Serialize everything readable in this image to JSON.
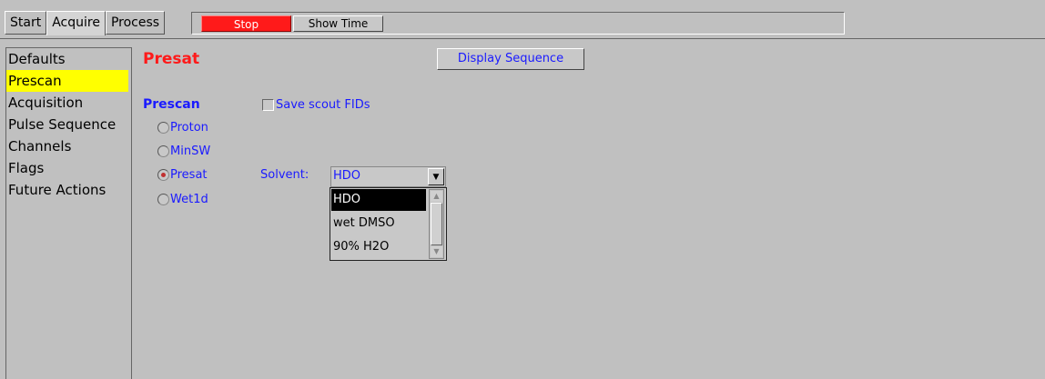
{
  "tabs": [
    {
      "label": "Start"
    },
    {
      "label": "Acquire"
    },
    {
      "label": "Process"
    }
  ],
  "toolbar": {
    "stop_label": "Stop",
    "show_time_label": "Show Time"
  },
  "sidebar": {
    "items": [
      {
        "label": "Defaults"
      },
      {
        "label": "Prescan"
      },
      {
        "label": "Acquisition"
      },
      {
        "label": "Pulse Sequence"
      },
      {
        "label": "Channels"
      },
      {
        "label": "Flags"
      },
      {
        "label": "Future Actions"
      }
    ],
    "selected": "Prescan"
  },
  "panel": {
    "title": "Presat",
    "display_sequence_label": "Display Sequence",
    "prescan_heading": "Prescan",
    "save_scout_label": "Save scout FIDs",
    "radios": [
      {
        "label": "Proton",
        "selected": false
      },
      {
        "label": "MinSW",
        "selected": false
      },
      {
        "label": "Presat",
        "selected": true
      },
      {
        "label": "Wet1d",
        "selected": false
      }
    ],
    "solvent_label": "Solvent:",
    "solvent_value": "HDO",
    "solvent_options": [
      "HDO",
      "wet DMSO",
      "90% H2O"
    ]
  },
  "colors": {
    "accent_red": "#ff1a1a",
    "text_blue": "#1a1aff",
    "selected_yellow": "#ffff00",
    "background": "#c0c0c0"
  }
}
